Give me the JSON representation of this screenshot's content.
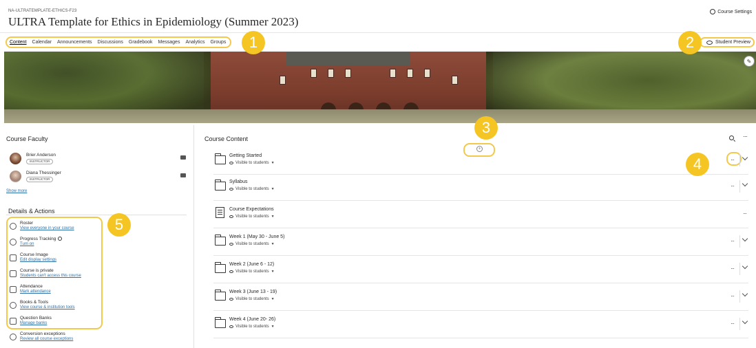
{
  "header": {
    "course_id": "NA-ULTRATEMPLATE-ETHICS-F23",
    "title": "ULTRA Template for Ethics in Epidemiology (Summer 2023)",
    "settings_label": "Course Settings"
  },
  "nav": {
    "tabs": [
      {
        "label": "Content"
      },
      {
        "label": "Calendar"
      },
      {
        "label": "Announcements"
      },
      {
        "label": "Discussions"
      },
      {
        "label": "Gradebook"
      },
      {
        "label": "Messages"
      },
      {
        "label": "Analytics"
      },
      {
        "label": "Groups"
      }
    ],
    "active_tab": "Content",
    "student_preview_label": "Student Preview"
  },
  "callouts": [
    "1",
    "2",
    "3",
    "4",
    "5"
  ],
  "faculty": {
    "heading": "Course Faculty",
    "members": [
      {
        "name": "Brier Anderson",
        "role": "INSTRUCTOR"
      },
      {
        "name": "Diana Thessinger",
        "role": "INSTRUCTOR"
      }
    ],
    "show_more": "Show more"
  },
  "details": {
    "heading": "Details & Actions",
    "items": [
      {
        "title": "Roster",
        "link": "View everyone in your course",
        "icon": "roster-icon"
      },
      {
        "title": "Progress Tracking",
        "link": "Turn on",
        "icon": "progress-check-icon"
      },
      {
        "title": "Course Image",
        "link": "Edit display settings",
        "icon": "image-icon"
      },
      {
        "title": "Course is private",
        "link": "Students can't access this course",
        "icon": "lock-icon"
      },
      {
        "title": "Attendance",
        "link": "Mark attendance",
        "icon": "attendance-icon"
      },
      {
        "title": "Books & Tools",
        "link": "View course & institution tools",
        "icon": "tools-icon"
      },
      {
        "title": "Question Banks",
        "link": "Manage banks",
        "icon": "question-bank-icon"
      },
      {
        "title": "Conversion exceptions",
        "link": "Review all course exceptions",
        "icon": "conversion-icon"
      }
    ]
  },
  "content": {
    "heading": "Course Content",
    "items": [
      {
        "title": "Getting Started",
        "visibility": "Visible to students",
        "type": "folder"
      },
      {
        "title": "Syllabus",
        "visibility": "Visible to students",
        "type": "folder"
      },
      {
        "title": "Course Expectations",
        "visibility": "Visible to students",
        "type": "document"
      },
      {
        "title": "Week 1 (May 30 - June 5)",
        "visibility": "Visible to students",
        "type": "folder"
      },
      {
        "title": "Week 2 (June 6 - 12)",
        "visibility": "Visible to students",
        "type": "folder"
      },
      {
        "title": "Week 3 (June 13 - 19)",
        "visibility": "Visible to students",
        "type": "folder"
      },
      {
        "title": "Week 4 (June 20- 26)",
        "visibility": "Visible to students",
        "type": "folder"
      }
    ]
  },
  "colors": {
    "callout": "#f5c523",
    "highlight": "#f2c94c",
    "link": "#2c6fa8"
  }
}
